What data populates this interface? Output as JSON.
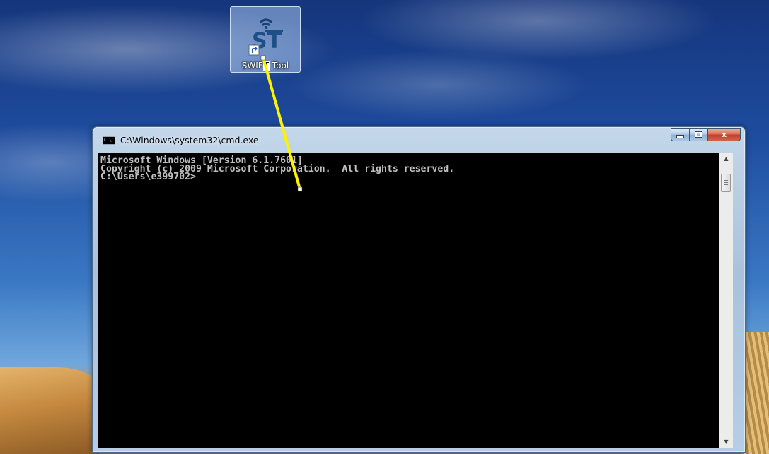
{
  "desktop": {
    "icon": {
      "label_pre": "SWIF",
      "label_highlight": "T",
      "label_post": "Tool",
      "logo_text": "ST",
      "icon_name": "swift-tool-shortcut-icon"
    }
  },
  "window": {
    "title": "C:\\Windows\\system32\\cmd.exe",
    "icon_text": "C:\\.",
    "controls": {
      "minimize_icon": "minimize-icon",
      "maximize_icon": "maximize-icon",
      "close_glyph": "x"
    }
  },
  "console": {
    "lines": [
      "Microsoft Windows [Version 6.1.7601]",
      "Copyright (c) 2009 Microsoft Corporation.  All rights reserved.",
      "",
      "C:\\Users\\e399702>"
    ],
    "background": "#000000",
    "foreground": "#C0C0C0"
  },
  "scrollbar": {
    "up_glyph": "▲",
    "down_glyph": "▼"
  },
  "annotation": {
    "color": "#FFF200"
  }
}
